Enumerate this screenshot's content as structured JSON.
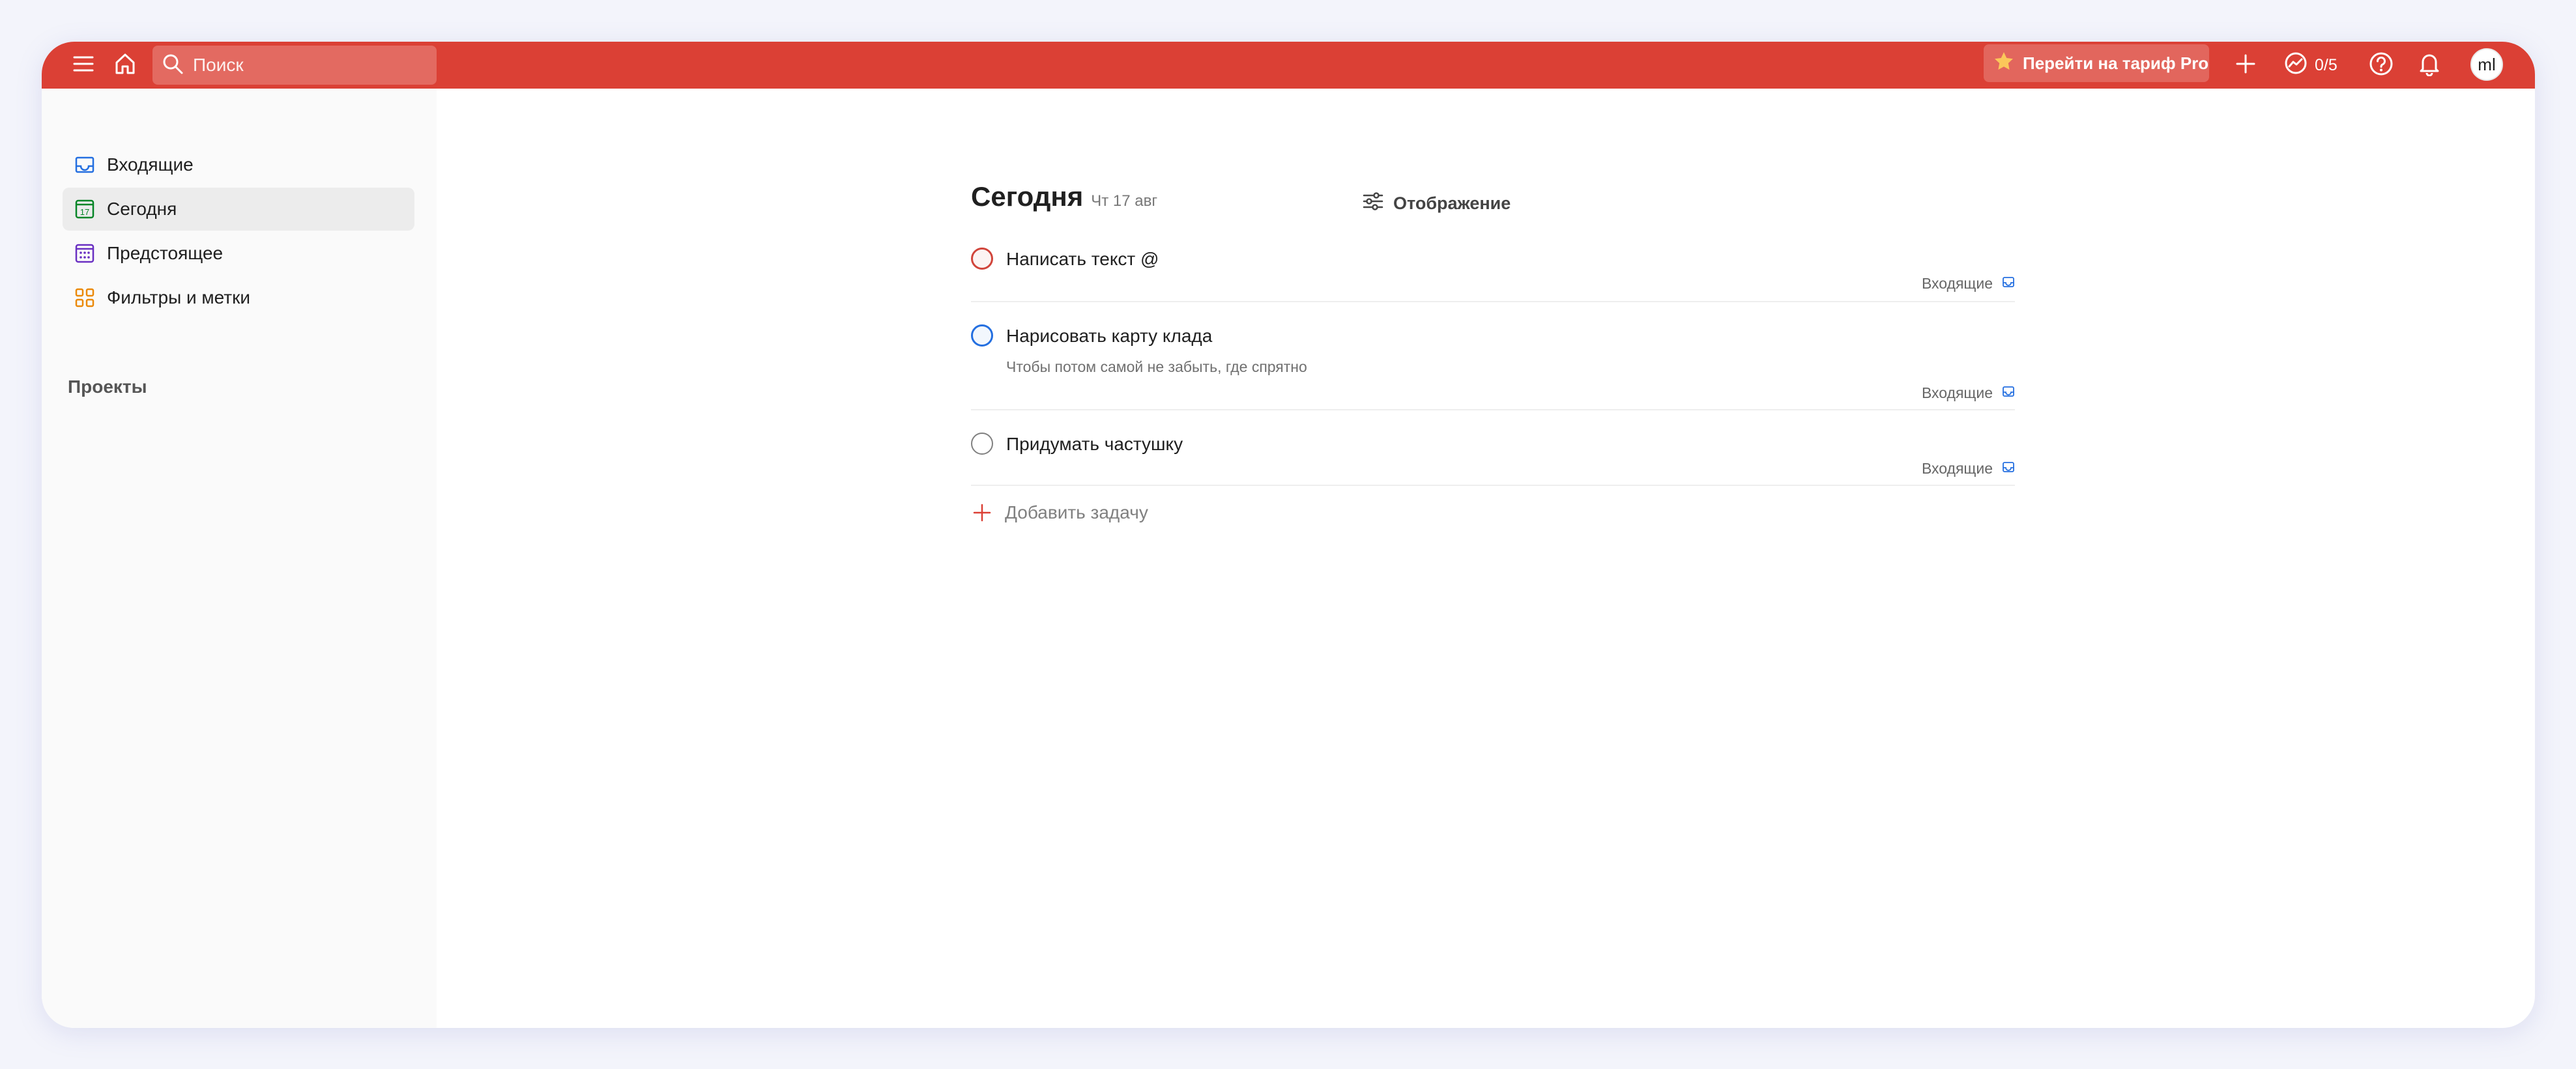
{
  "topbar": {
    "search_placeholder": "Поиск",
    "pro_label": "Перейти на тариф Pro",
    "karma_text": "0/5",
    "avatar_initials": "ml",
    "accent_color": "#db4035"
  },
  "sidebar": {
    "items": [
      {
        "label": "Входящие",
        "icon": "inbox-icon",
        "color": "#246fe0"
      },
      {
        "label": "Сегодня",
        "icon": "calendar-today-icon",
        "color": "#058527",
        "badge": "17"
      },
      {
        "label": "Предстоящее",
        "icon": "calendar-upcoming-icon",
        "color": "#692fc2"
      },
      {
        "label": "Фильтры и метки",
        "icon": "filters-icon",
        "color": "#eb8909"
      }
    ],
    "projects_title": "Проекты"
  },
  "main": {
    "title": "Сегодня",
    "date": "Чт 17 авг",
    "view_label": "Отображение",
    "tasks": [
      {
        "name": "Написать текст @",
        "description": "",
        "project": "Входящие",
        "priority_color": "#d1453b"
      },
      {
        "name": "Нарисовать карту клада",
        "description": "Чтобы потом самой не забыть, где спрятно",
        "project": "Входящие",
        "priority_color": "#246fe0"
      },
      {
        "name": "Придумать частушку",
        "description": "",
        "project": "Входящие",
        "priority_color": "#808080"
      }
    ],
    "add_task_label": "Добавить задачу"
  }
}
